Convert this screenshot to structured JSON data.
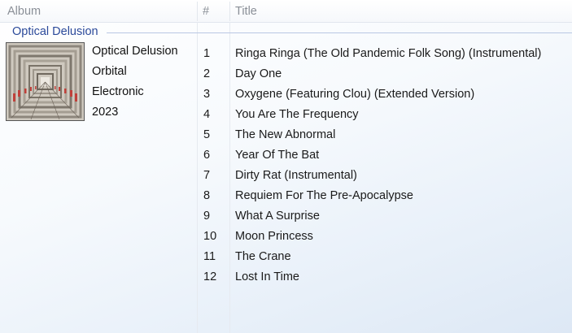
{
  "columns": {
    "album": "Album",
    "number": "#",
    "title": "Title"
  },
  "group": {
    "label": "Optical Delusion"
  },
  "album_info": {
    "album": "Optical Delusion",
    "artist": "Orbital",
    "genre": "Electronic",
    "year": "2023",
    "cover_icon": "album-cover-art"
  },
  "tracks": [
    {
      "number": "1",
      "title": "Ringa Ringa (The Old Pandemic Folk Song) (Instrumental)"
    },
    {
      "number": "2",
      "title": "Day One"
    },
    {
      "number": "3",
      "title": "Oxygene (Featuring Clou) (Extended Version)"
    },
    {
      "number": "4",
      "title": "You Are The Frequency"
    },
    {
      "number": "5",
      "title": "The New Abnormal"
    },
    {
      "number": "6",
      "title": "Year Of The Bat"
    },
    {
      "number": "7",
      "title": "Dirty Rat (Instrumental)"
    },
    {
      "number": "8",
      "title": "Requiem For The Pre-Apocalypse"
    },
    {
      "number": "9",
      "title": "What A Surprise"
    },
    {
      "number": "10",
      "title": "Moon Princess"
    },
    {
      "number": "11",
      "title": "The Crane"
    },
    {
      "number": "12",
      "title": "Lost In Time"
    }
  ],
  "colors": {
    "group_label": "#2b4a9a",
    "header_text": "#8a8f97"
  }
}
